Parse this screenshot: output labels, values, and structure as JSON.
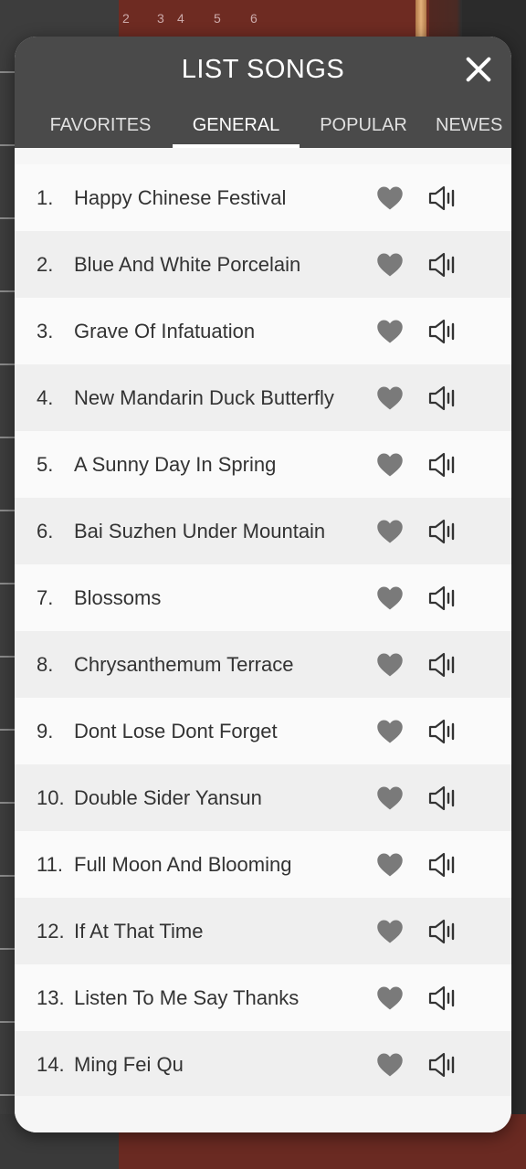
{
  "header": {
    "title": "LIST SONGS",
    "close_icon": "close-icon"
  },
  "tabs": [
    {
      "label": "FAVORITES",
      "active": false
    },
    {
      "label": "GENERAL",
      "active": true
    },
    {
      "label": "POPULAR",
      "active": false
    },
    {
      "label": "NEWES",
      "active": false
    }
  ],
  "songs": [
    {
      "num": "1.",
      "title": "Happy Chinese Festival"
    },
    {
      "num": "2.",
      "title": "Blue And White Porcelain"
    },
    {
      "num": "3.",
      "title": "Grave Of Infatuation"
    },
    {
      "num": "4.",
      "title": "New Mandarin Duck Butterfly"
    },
    {
      "num": "5.",
      "title": "A Sunny Day In Spring"
    },
    {
      "num": "6.",
      "title": "Bai Suzhen Under Mountain"
    },
    {
      "num": "7.",
      "title": "Blossoms"
    },
    {
      "num": "8.",
      "title": "Chrysanthemum Terrace"
    },
    {
      "num": "9.",
      "title": "Dont Lose Dont Forget"
    },
    {
      "num": "10.",
      "title": "Double Sider Yansun"
    },
    {
      "num": "11.",
      "title": "Full Moon And Blooming"
    },
    {
      "num": "12.",
      "title": "If At That Time"
    },
    {
      "num": "13.",
      "title": "Listen To Me Say Thanks"
    },
    {
      "num": "14.",
      "title": "Ming Fei Qu"
    }
  ],
  "icons": {
    "favorite": "heart-icon",
    "play": "speaker-icon"
  },
  "background": {
    "ruler_marks": [
      "2",
      "3",
      "4",
      "5",
      "6"
    ]
  },
  "colors": {
    "header_bg": "#4a4a4a",
    "list_bg": "#f6f6f6",
    "row_alt_bg": "#efefef",
    "icon_gray": "#7a7a7a",
    "text": "#333333"
  }
}
